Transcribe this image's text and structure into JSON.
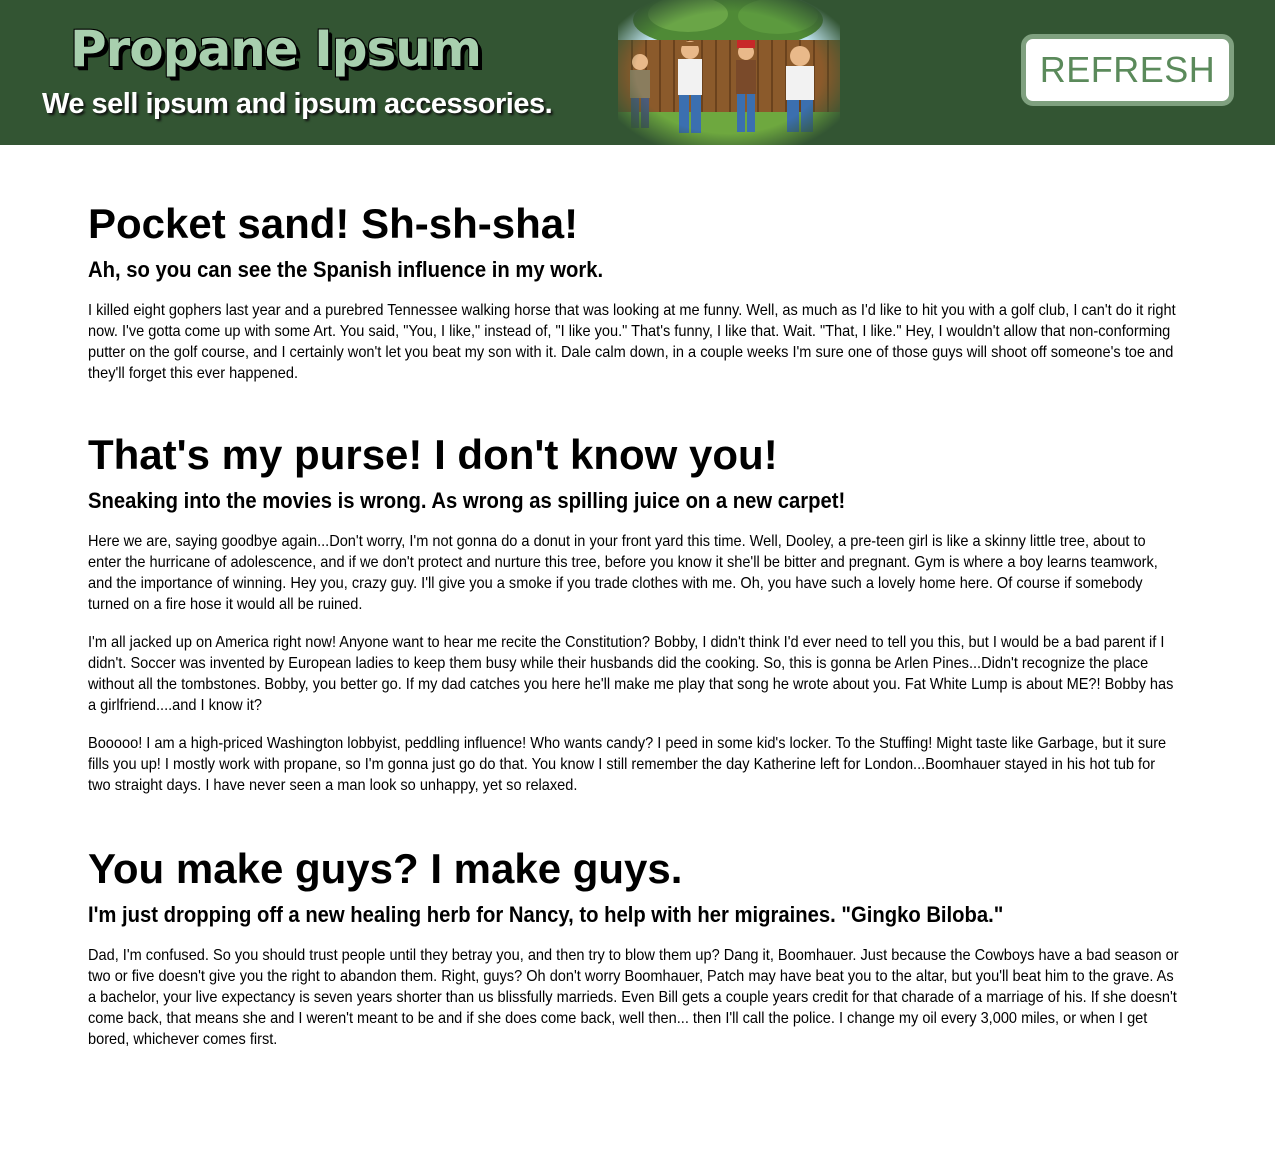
{
  "header": {
    "logo_text": "Propane Ipsum",
    "tagline": "We sell ipsum and ipsum accessories.",
    "refresh_label": "REFRESH",
    "background_color": "#335533",
    "logo_color": "#a8cfae"
  },
  "sections": [
    {
      "title": "Pocket sand! Sh-sh-sha!",
      "subtitle": "Ah, so you can see the Spanish influence in my work.",
      "paragraphs": [
        "I killed eight gophers last year and a purebred Tennessee walking horse that was looking at me funny. Well, as much as I'd like to hit you with a golf club, I can't do it right now. I've gotta come up with some Art. You said, \"You, I like,\" instead of, \"I like you.\" That's funny, I like that. Wait. \"That, I like.\" Hey, I wouldn't allow that non-conforming putter on the golf course, and I certainly won't let you beat my son with it. Dale calm down, in a couple weeks I'm sure one of those guys will shoot off someone's toe and they'll forget this ever happened."
      ]
    },
    {
      "title": "That's my purse! I don't know you!",
      "subtitle": "Sneaking into the movies is wrong. As wrong as spilling juice on a new carpet!",
      "paragraphs": [
        "Here we are, saying goodbye again...Don't worry, I'm not gonna do a donut in your front yard this time. Well, Dooley, a pre-teen girl is like a skinny little tree, about to enter the hurricane of adolescence, and if we don't protect and nurture this tree, before you know it she'll be bitter and pregnant. Gym is where a boy learns teamwork, and the importance of winning. Hey you, crazy guy. I'll give you a smoke if you trade clothes with me. Oh, you have such a lovely home here. Of course if somebody turned on a fire hose it would all be ruined.",
        "I'm all jacked up on America right now! Anyone want to hear me recite the Constitution? Bobby, I didn't think I'd ever need to tell you this, but I would be a bad parent if I didn't. Soccer was invented by European ladies to keep them busy while their husbands did the cooking. So, this is gonna be Arlen Pines...Didn't recognize the place without all the tombstones. Bobby, you better go. If my dad catches you here he'll make me play that song he wrote about you. Fat White Lump is about ME?! Bobby has a girlfriend....and I know it?",
        "Booooo! I am a high-priced Washington lobbyist, peddling influence! Who wants candy? I peed in some kid's locker. To the Stuffing! Might taste like Garbage, but it sure fills you up! I mostly work with propane, so I'm gonna just go do that. You know I still remember the day Katherine left for London...Boomhauer stayed in his hot tub for two straight days. I have never seen a man look so unhappy, yet so relaxed."
      ]
    },
    {
      "title": "You make guys? I make guys.",
      "subtitle": "I'm just dropping off a new healing herb for Nancy, to help with her migraines. \"Gingko Biloba.\"",
      "paragraphs": [
        "Dad, I'm confused. So you should trust people until they betray you, and then try to blow them up? Dang it, Boomhauer. Just because the Cowboys have a bad season or two or five doesn't give you the right to abandon them. Right, guys? Oh don't worry Boomhauer, Patch may have beat you to the altar, but you'll beat him to the grave. As a bachelor, your live expectancy is seven years shorter than us blissfully marrieds. Even Bill gets a couple years credit for that charade of a marriage of his. If she doesn't come back, that means she and I weren't meant to be and if she does come back, well then... then I'll call the police. I change my oil every 3,000 miles, or when I get bored, whichever comes first."
      ]
    }
  ]
}
